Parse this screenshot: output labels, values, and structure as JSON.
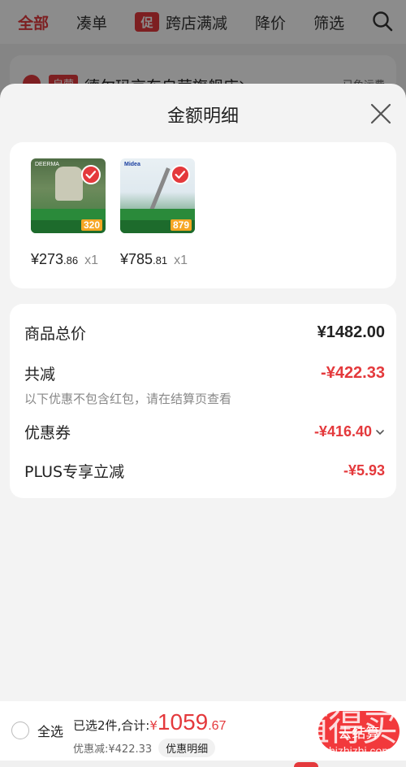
{
  "topnav": {
    "tabs": [
      {
        "label": "全部",
        "active": true
      },
      {
        "label": "凑单",
        "active": false
      },
      {
        "label": "跨店满减",
        "active": false,
        "tag": "促"
      },
      {
        "label": "降价",
        "active": false
      },
      {
        "label": "筛选",
        "active": false
      }
    ],
    "search_icon": "search-icon"
  },
  "store": {
    "tag": "自营",
    "name": "德尔玛京东自营旗舰店",
    "chevron": "›",
    "right_text": "已免运费"
  },
  "sheet": {
    "title": "金额明细",
    "close_icon": "close-icon",
    "goods": [
      {
        "price_int": "¥273",
        "price_dec": ".86",
        "qty": "x1",
        "image_brand": "DEERMA",
        "image_price": "320"
      },
      {
        "price_int": "¥785",
        "price_dec": ".81",
        "qty": "x1",
        "image_brand": "Midea",
        "image_price": "879"
      }
    ],
    "details": {
      "total_label": "商品总价",
      "total_value": "¥1482.00",
      "reduce_label": "共减",
      "reduce_value": "-¥422.33",
      "note": "以下优惠不包含红包，请在结算页查看",
      "coupon_label": "优惠券",
      "coupon_value": "-¥416.40",
      "plus_label": "PLUS专享立减",
      "plus_value": "-¥5.93"
    }
  },
  "bottom": {
    "select_all": "全选",
    "summary_text": "已选2件,合计:",
    "currency": "¥",
    "total_int": "1059",
    "total_dec": ".67",
    "saved_text": "优惠减:¥422.33",
    "detail_btn": "优惠明细",
    "checkout": "去结算"
  },
  "watermark": {
    "big": "值得买",
    "small": "zhizhizhi.com"
  },
  "colors": {
    "accent": "#e4393c",
    "sheet_bg": "#f3f3f3",
    "card_bg": "#ffffff"
  }
}
